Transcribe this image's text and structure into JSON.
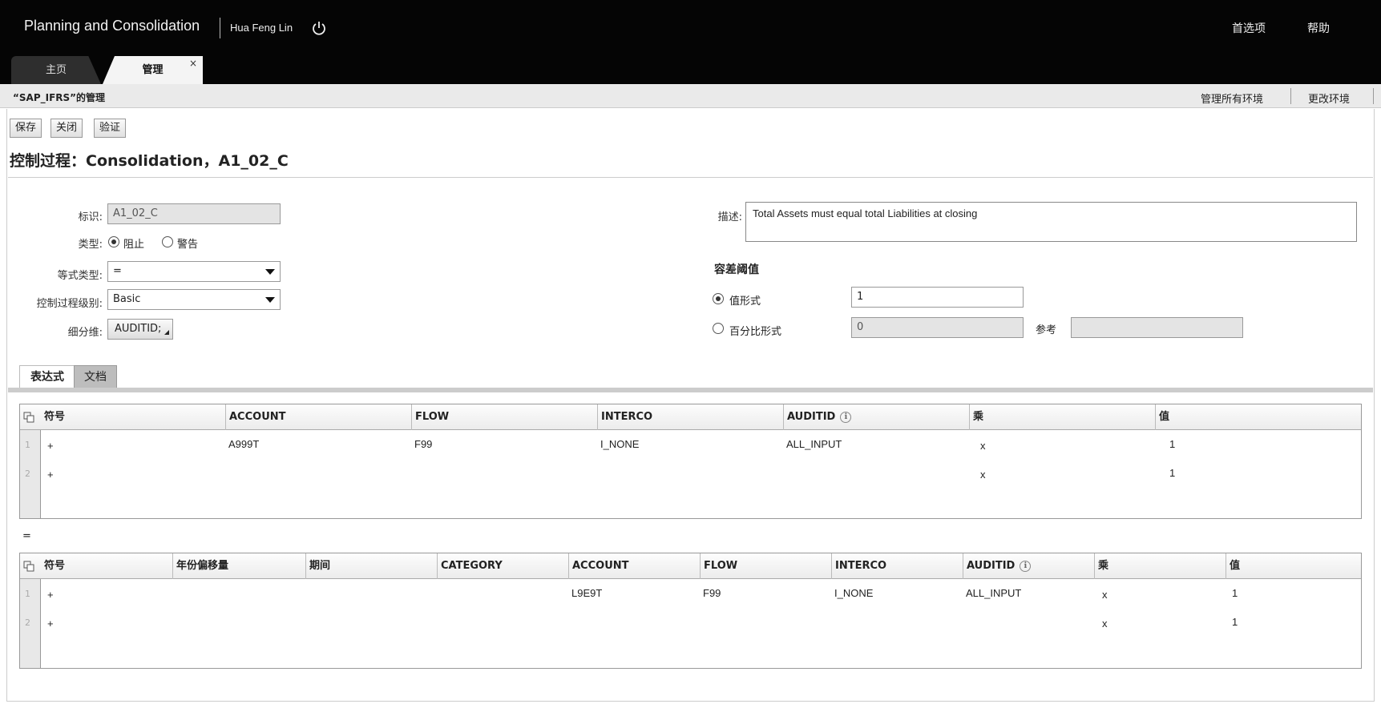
{
  "header": {
    "app_title": "Planning and Consolidation",
    "user": "Hua Feng Lin",
    "preferences": "首选项",
    "help": "帮助",
    "power_icon": "power-icon"
  },
  "tabs": [
    {
      "label": "主页"
    },
    {
      "label": "管理",
      "close": "×"
    }
  ],
  "subheader": {
    "title": "“SAP_IFRS”的管理",
    "manage_all": "管理所有环境",
    "change_env": "更改环境"
  },
  "toolbar": {
    "save": "保存",
    "close": "关闭",
    "validate": "验证"
  },
  "page_title": "控制过程：Consolidation，A1_02_C",
  "form": {
    "id_label": "标识:",
    "id_value": "A1_02_C",
    "type_label": "类型:",
    "type_block": "阻止",
    "type_warn": "警告",
    "eq_type_label": "等式类型:",
    "eq_type_value": "=",
    "level_label": "控制过程级别:",
    "level_value": "Basic",
    "breakdown_label": "细分维:",
    "breakdown_value": "AUDITID;",
    "desc_label": "描述:",
    "desc_value": "Total Assets must equal total Liabilities at closing",
    "tolerance_title": "容差阈值",
    "value_form": "值形式",
    "value_form_value": "1",
    "percent_form": "百分比形式",
    "percent_value": "0",
    "reference_label": "参考",
    "reference_value": ""
  },
  "subtabs": {
    "expression": "表达式",
    "document": "文档"
  },
  "table1": {
    "columns": [
      "符号",
      "ACCOUNT",
      "FLOW",
      "INTERCO",
      "AUDITID",
      "乘",
      "值"
    ],
    "rows": [
      {
        "num": "1",
        "sign": "+",
        "account": "A999T",
        "flow": "F99",
        "interco": "I_NONE",
        "auditid": "ALL_INPUT",
        "mult": "x",
        "value": "1"
      },
      {
        "num": "2",
        "sign": "+",
        "account": "",
        "flow": "",
        "interco": "",
        "auditid": "",
        "mult": "x",
        "value": "1"
      }
    ]
  },
  "equals": "=",
  "table2": {
    "columns": [
      "符号",
      "年份偏移量",
      "期间",
      "CATEGORY",
      "ACCOUNT",
      "FLOW",
      "INTERCO",
      "AUDITID",
      "乘",
      "值"
    ],
    "rows": [
      {
        "num": "1",
        "sign": "+",
        "account": "L9E9T",
        "flow": "F99",
        "interco": "I_NONE",
        "auditid": "ALL_INPUT",
        "mult": "x",
        "value": "1"
      },
      {
        "num": "2",
        "sign": "+",
        "account": "",
        "flow": "",
        "interco": "",
        "auditid": "",
        "mult": "x",
        "value": "1"
      }
    ]
  },
  "info_icon": "ℹ"
}
